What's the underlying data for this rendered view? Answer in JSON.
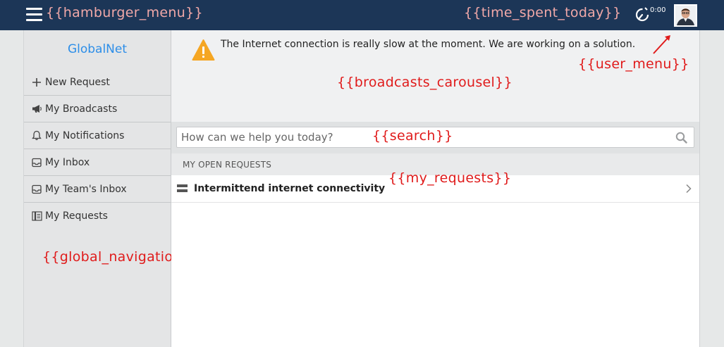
{
  "annotations": {
    "hamburger_menu": "{{hamburger_menu}}",
    "time_spent_today": "{{time_spent_today}}",
    "user_menu": "{{user_menu}}",
    "broadcasts_carousel": "{{broadcasts_carousel}}",
    "search": "{{search}}",
    "my_requests": "{{my_requests}}",
    "global_navigation_menu": "{{global_navigation_menu}}"
  },
  "header": {
    "timer_value": "0:00",
    "timer_icon": "stopwatch-icon",
    "avatar_icon": "user-avatar",
    "menu_icon": "hamburger-icon"
  },
  "sidebar": {
    "brand": "GlobalNet",
    "items": [
      {
        "label": "New Request",
        "icon": "plus-icon"
      },
      {
        "label": "My Broadcasts",
        "icon": "megaphone-icon"
      },
      {
        "label": "My Notifications",
        "icon": "bell-icon"
      },
      {
        "label": "My Inbox",
        "icon": "inbox-icon"
      },
      {
        "label": "My Team's Inbox",
        "icon": "inbox-icon"
      },
      {
        "label": "My Requests",
        "icon": "requests-icon"
      }
    ]
  },
  "broadcast": {
    "message": "The Internet connection is really slow at the moment. We are working on a solution.",
    "icon": "warning-icon"
  },
  "search": {
    "placeholder": "How can we help you today?",
    "icon": "search-icon"
  },
  "requests": {
    "heading": "MY OPEN REQUESTS",
    "items": [
      {
        "title": "Intermittend internet connectivity"
      }
    ]
  },
  "colors": {
    "topbar": "#1c3657",
    "brand": "#2d8ee8",
    "annotation": "#e01b1b",
    "warning": "#f5a623"
  }
}
